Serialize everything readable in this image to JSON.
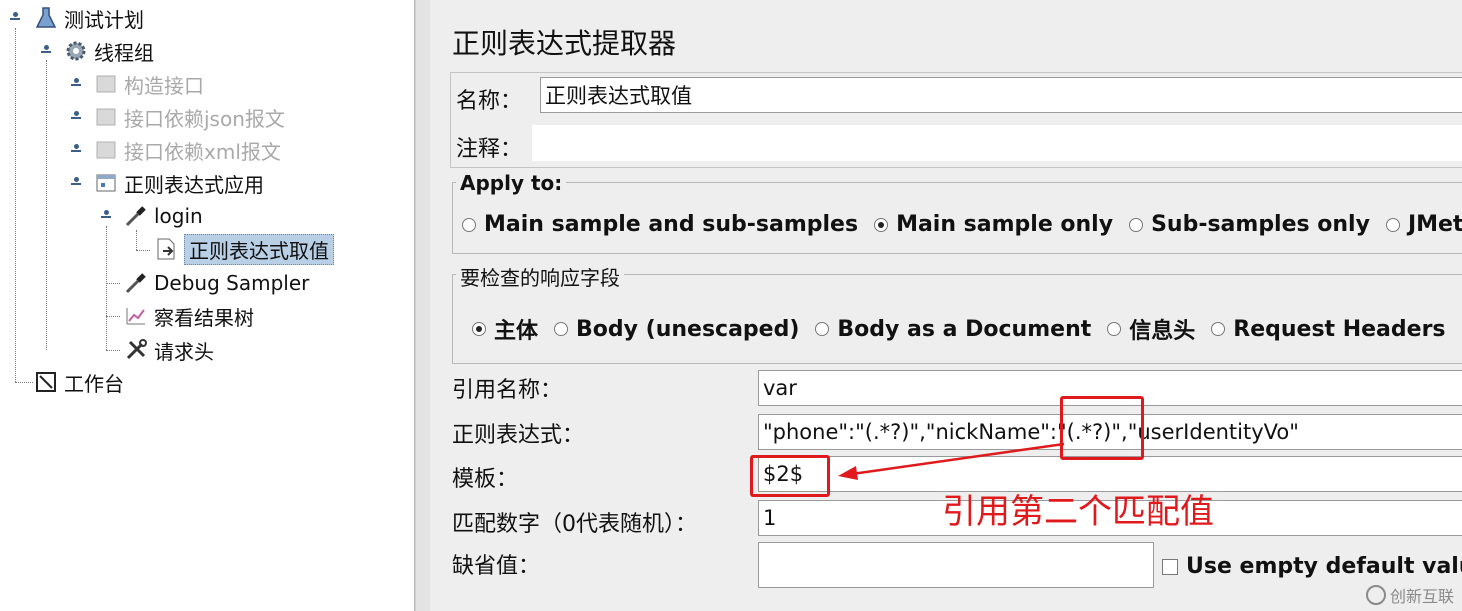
{
  "tree": {
    "items": [
      {
        "label": "测试计划",
        "icon": "flask-icon"
      },
      {
        "label": "线程组",
        "icon": "gear-icon"
      },
      {
        "label": "构造接口",
        "icon": "sampler-disabled-icon"
      },
      {
        "label": "接口依赖json报文",
        "icon": "sampler-disabled-icon"
      },
      {
        "label": "接口依赖xml报文",
        "icon": "sampler-disabled-icon"
      },
      {
        "label": "正则表达式应用",
        "icon": "controller-icon"
      },
      {
        "label": "login",
        "icon": "pipette-icon"
      },
      {
        "label": "正则表达式取值",
        "icon": "extractor-icon"
      },
      {
        "label": "Debug Sampler",
        "icon": "pipette-icon"
      },
      {
        "label": "察看结果树",
        "icon": "chart-icon"
      },
      {
        "label": "请求头",
        "icon": "wrench-icon"
      },
      {
        "label": "工作台",
        "icon": "workbench-icon"
      }
    ]
  },
  "panel": {
    "title": "正则表达式提取器",
    "name_label": "名称：",
    "name_value": "正则表达式取值",
    "comment_label": "注释：",
    "comment_value": "",
    "apply_to": {
      "title": "Apply to:",
      "options": [
        "Main sample and sub-samples",
        "Main sample only",
        "Sub-samples only",
        "JMeter"
      ],
      "selected": 1
    },
    "field_to_check": {
      "title": "要检查的响应字段",
      "options": [
        "主体",
        "Body (unescaped)",
        "Body as a Document",
        "信息头",
        "Request Headers"
      ],
      "selected": 0
    },
    "ref_name_label": "引用名称：",
    "ref_name_value": "var",
    "regex_label": "正则表达式：",
    "regex_value": "\"phone\":\"(.*?)\",\"nickName\":\"(.*?)\",\"userIdentityVo\"",
    "template_label": "模板：",
    "template_value": "$2$",
    "match_no_label": "匹配数字（0代表随机）：",
    "match_no_value": "1",
    "default_label": "缺省值：",
    "default_value": "",
    "use_empty_label": "Use empty default value"
  },
  "annotation": {
    "text": "引用第二个匹配值",
    "color": "#e0191c"
  },
  "watermark": {
    "text": "创新互联"
  }
}
